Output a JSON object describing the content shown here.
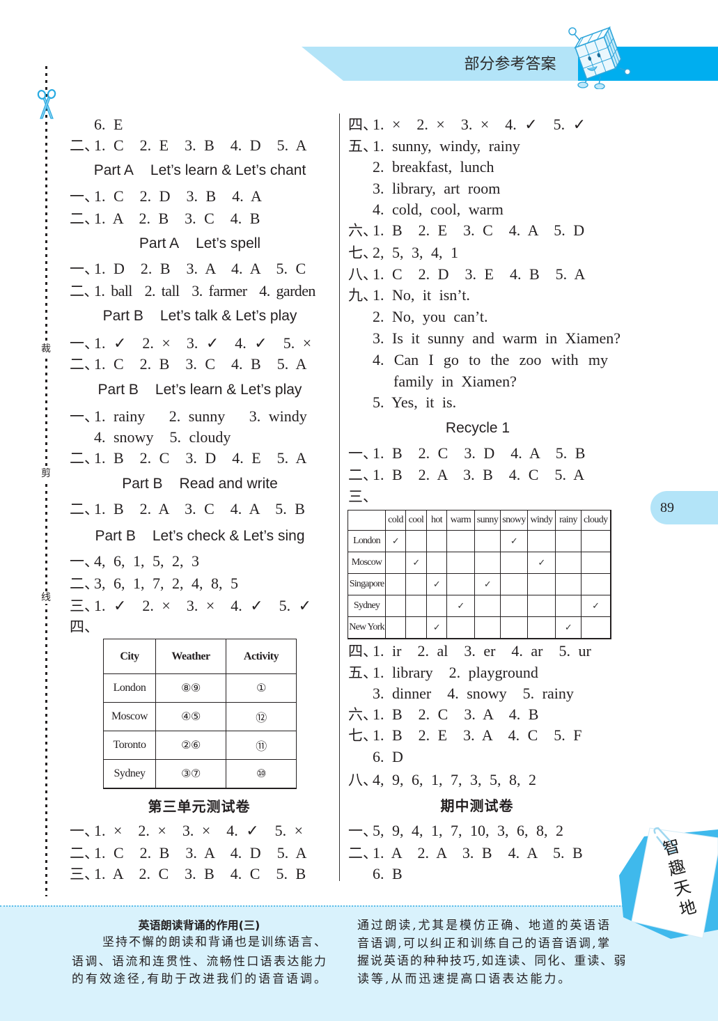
{
  "header": {
    "title": "部分参考答案"
  },
  "margin_marks": {
    "cut": "裁",
    "clip": "剪",
    "line": "线"
  },
  "page_number": "89",
  "left": {
    "continued": "6. E",
    "intro_row": {
      "label": "二、",
      "text": "1. C  2. E  3. B  4. D  5. A"
    },
    "sections": [
      {
        "part": "Part A",
        "title": "Let’s learn & Let’s chant",
        "rows": [
          {
            "label": "一、",
            "text": "1. C  2. D  3. B  4. A"
          },
          {
            "label": "二、",
            "text": "1. A  2. B  3. C  4. B"
          }
        ]
      },
      {
        "part": "Part A",
        "title": "Let’s spell",
        "rows": [
          {
            "label": "一、",
            "text": "1. D  2. B  3. A  4. A  5. C"
          },
          {
            "label": "二、",
            "text": "1. ball  2. tall  3. farmer  4. garden"
          }
        ]
      },
      {
        "part": "Part B",
        "title": "Let’s talk & Let’s play",
        "rows": [
          {
            "label": "一、",
            "text": "1. ✓  2. ×  3. ✓  4. ✓  5. ×"
          },
          {
            "label": "二、",
            "text": "1. C  2. B  3. C  4. B  5. A"
          }
        ]
      },
      {
        "part": "Part B",
        "title": "Let’s learn & Let’s play",
        "rows": [
          {
            "label": "一、",
            "text": "1. rainy   2. sunny   3. windy"
          },
          {
            "text": "4. snowy  5. cloudy"
          },
          {
            "label": "二、",
            "text": "1. B  2. C  3. D  4. E  5. A"
          }
        ]
      },
      {
        "part": "Part B",
        "title": "Read and write",
        "rows": [
          {
            "label": "二、",
            "text": "1. B  2. A  3. C  4. A  5. B"
          }
        ]
      },
      {
        "part": "Part B",
        "title": "Let’s check & Let’s sing",
        "rows": [
          {
            "label": "一、",
            "text": "4, 6, 1, 5, 2, 3"
          },
          {
            "label": "二、",
            "text": "3, 6, 1, 7, 2, 4, 8, 5"
          },
          {
            "label": "三、",
            "text": "1. ✓  2. ×  3. ×  4. ✓  5. ✓"
          },
          {
            "label": "四、"
          }
        ],
        "table": {
          "headers": [
            "City",
            "Weather",
            "Activity"
          ],
          "rows": [
            [
              "London",
              "⑧⑨",
              "①"
            ],
            [
              "Moscow",
              "④⑤",
              "⑫"
            ],
            [
              "Toronto",
              "②⑥",
              "⑪"
            ],
            [
              "Sydney",
              "③⑦",
              "⑩"
            ]
          ]
        }
      }
    ],
    "unit_test": {
      "title": "第三单元测试卷",
      "rows": [
        {
          "label": "一、",
          "text": "1. ×  2. ×  3. ×  4. ✓  5. ×"
        },
        {
          "label": "二、",
          "text": "1. C  2. B  3. A  4. D  5. A"
        },
        {
          "label": "三、",
          "text": "1. A  2. C  3. B  4. C  5. B"
        }
      ]
    }
  },
  "right": {
    "rows": [
      {
        "label": "四、",
        "text": "1. ×  2. ×  3. ×  4. ✓  5. ✓"
      },
      {
        "label": "五、",
        "text": "1. sunny, windy, rainy"
      },
      {
        "text": "2. breakfast, lunch"
      },
      {
        "text": "3. library, art room"
      },
      {
        "text": "4. cold, cool, warm"
      },
      {
        "label": "六、",
        "text": "1. B  2. E  3. C  4. A  5. D"
      },
      {
        "label": "七、",
        "text": "2, 5, 3, 4, 1"
      },
      {
        "label": "八、",
        "text": "1. C  2. D  3. E  4. B  5. A"
      },
      {
        "label": "九、",
        "text": "1. No, it isn’t."
      },
      {
        "text": "2. No, you can’t."
      },
      {
        "text": "3. Is it sunny and warm in Xiamen?"
      },
      {
        "text": "4. Can I go to the zoo with my"
      },
      {
        "text": "family in Xiamen?"
      },
      {
        "text": "5. Yes, it is."
      }
    ],
    "recycle": {
      "title": "Recycle 1",
      "rows": [
        {
          "label": "一、",
          "text": "1. B  2. C  3. D  4. A  5. B"
        },
        {
          "label": "二、",
          "text": "1. B  2. A  3. B  4. C  5. A"
        },
        {
          "label": "三、"
        }
      ],
      "table": {
        "headers": [
          "",
          "cold",
          "cool",
          "hot",
          "warm",
          "sunny",
          "snowy",
          "windy",
          "rainy",
          "cloudy"
        ],
        "rows": [
          {
            "city": "London",
            "cells": [
              "✓",
              "",
              "",
              "",
              "",
              "✓",
              "",
              "",
              ""
            ]
          },
          {
            "city": "Moscow",
            "cells": [
              "",
              "✓",
              "",
              "",
              "",
              "",
              "✓",
              "",
              ""
            ]
          },
          {
            "city": "Singapore",
            "cells": [
              "",
              "",
              "✓",
              "",
              "✓",
              "",
              "",
              "",
              ""
            ]
          },
          {
            "city": "Sydney",
            "cells": [
              "",
              "",
              "",
              "✓",
              "",
              "",
              "",
              "",
              "✓"
            ]
          },
          {
            "city": "New York",
            "cells": [
              "",
              "",
              "✓",
              "",
              "",
              "",
              "",
              "✓",
              ""
            ]
          }
        ]
      },
      "rows_after": [
        {
          "label": "四、",
          "text": "1. ir  2. al  3. er  4. ar  5. ur"
        },
        {
          "label": "五、",
          "text": "1. library  2. playground"
        },
        {
          "text": "3. dinner  4. snowy  5. rainy"
        },
        {
          "label": "六、",
          "text": "1. B  2. C  3. A  4. B"
        },
        {
          "label": "七、",
          "text": "1. B  2. E  3. A  4. C  5. F"
        },
        {
          "text": "6. D"
        },
        {
          "label": "八、",
          "text": "4, 9, 6, 1, 7, 3, 5, 8, 2"
        }
      ]
    },
    "midterm": {
      "title": "期中测试卷",
      "rows": [
        {
          "label": "一、",
          "text": "5, 9, 4, 1, 7, 10, 3, 6, 8, 2"
        },
        {
          "label": "二、",
          "text": "1. A  2. A  3. B  4. A  5. B"
        },
        {
          "text": "6. B"
        }
      ]
    }
  },
  "tip_box": {
    "title": "英语朗读背诵的作用(三)",
    "left_lines": [
      "坚持不懈的朗读和背诵也是训练语言、",
      "语调、语流和连贯性、流畅性口语表达能力",
      "的有效途径,有助于改进我们的语音语调。"
    ],
    "right_lines": [
      "通过朗读,尤其是模仿正确、地道的英语语",
      "音语调,可以纠正和训练自己的语音语调,掌",
      "握说英语的种种技巧,如连读、同化、重读、弱",
      "读等,从而迅速提高口语表达能力。"
    ]
  },
  "badge": {
    "text": "智趣天地"
  },
  "colors": {
    "banner_light": "#b3e4f8",
    "banner_dark": "#00aeef",
    "tip_bg": "#d9f2fc",
    "accent": "#29abe2"
  }
}
